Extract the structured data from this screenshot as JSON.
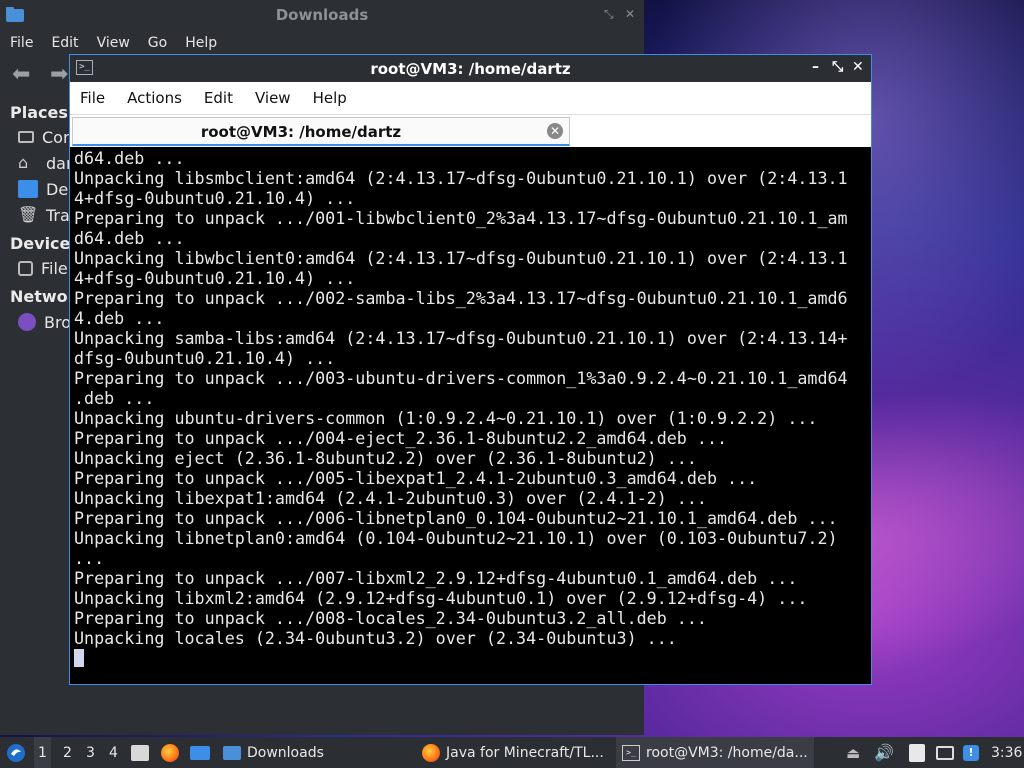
{
  "file_manager": {
    "title": "Downloads",
    "menu": [
      "File",
      "Edit",
      "View",
      "Go",
      "Help"
    ],
    "sidebar": {
      "places_heading": "Places",
      "places": [
        "Cor",
        "dar",
        "Des",
        "Tra"
      ],
      "devices_heading": "Devices",
      "devices": [
        "File"
      ],
      "network_heading": "Network",
      "network": [
        "Bro"
      ]
    }
  },
  "terminal": {
    "title": "root@VM3: /home/dartz",
    "menu": [
      "File",
      "Actions",
      "Edit",
      "View",
      "Help"
    ],
    "tab_label": "root@VM3: /home/dartz",
    "lines": [
      "d64.deb ...",
      "Unpacking libsmbclient:amd64 (2:4.13.17~dfsg-0ubuntu0.21.10.1) over (2:4.13.1",
      "4+dfsg-0ubuntu0.21.10.4) ...",
      "Preparing to unpack .../001-libwbclient0_2%3a4.13.17~dfsg-0ubuntu0.21.10.1_am",
      "d64.deb ...",
      "Unpacking libwbclient0:amd64 (2:4.13.17~dfsg-0ubuntu0.21.10.1) over (2:4.13.1",
      "4+dfsg-0ubuntu0.21.10.4) ...",
      "Preparing to unpack .../002-samba-libs_2%3a4.13.17~dfsg-0ubuntu0.21.10.1_amd6",
      "4.deb ...",
      "Unpacking samba-libs:amd64 (2:4.13.17~dfsg-0ubuntu0.21.10.1) over (2:4.13.14+",
      "dfsg-0ubuntu0.21.10.4) ...",
      "Preparing to unpack .../003-ubuntu-drivers-common_1%3a0.9.2.4~0.21.10.1_amd64",
      ".deb ...",
      "Unpacking ubuntu-drivers-common (1:0.9.2.4~0.21.10.1) over (1:0.9.2.2) ...",
      "Preparing to unpack .../004-eject_2.36.1-8ubuntu2.2_amd64.deb ...",
      "Unpacking eject (2.36.1-8ubuntu2.2) over (2.36.1-8ubuntu2) ...",
      "Preparing to unpack .../005-libexpat1_2.4.1-2ubuntu0.3_amd64.deb ...",
      "Unpacking libexpat1:amd64 (2.4.1-2ubuntu0.3) over (2.4.1-2) ...",
      "Preparing to unpack .../006-libnetplan0_0.104-0ubuntu2~21.10.1_amd64.deb ...",
      "Unpacking libnetplan0:amd64 (0.104-0ubuntu2~21.10.1) over (0.103-0ubuntu7.2)",
      "...",
      "Preparing to unpack .../007-libxml2_2.9.12+dfsg-4ubuntu0.1_amd64.deb ...",
      "Unpacking libxml2:amd64 (2.9.12+dfsg-4ubuntu0.1) over (2.9.12+dfsg-4) ...",
      "Preparing to unpack .../008-locales_2.34-0ubuntu3.2_all.deb ...",
      "Unpacking locales (2.34-0ubuntu3.2) over (2.34-0ubuntu3) ..."
    ]
  },
  "taskbar": {
    "workspaces": [
      "1",
      "2",
      "3",
      "4"
    ],
    "active_workspace": "1",
    "tasks": [
      "Downloads",
      "Java for Minecraft/TL...",
      "root@VM3: /home/da..."
    ],
    "clock": "3:36"
  },
  "colors": {
    "accent": "#3d8ee6",
    "panel": "#2b2e32",
    "terminal_bg": "#000000",
    "terminal_fg": "#e8e8e8"
  }
}
